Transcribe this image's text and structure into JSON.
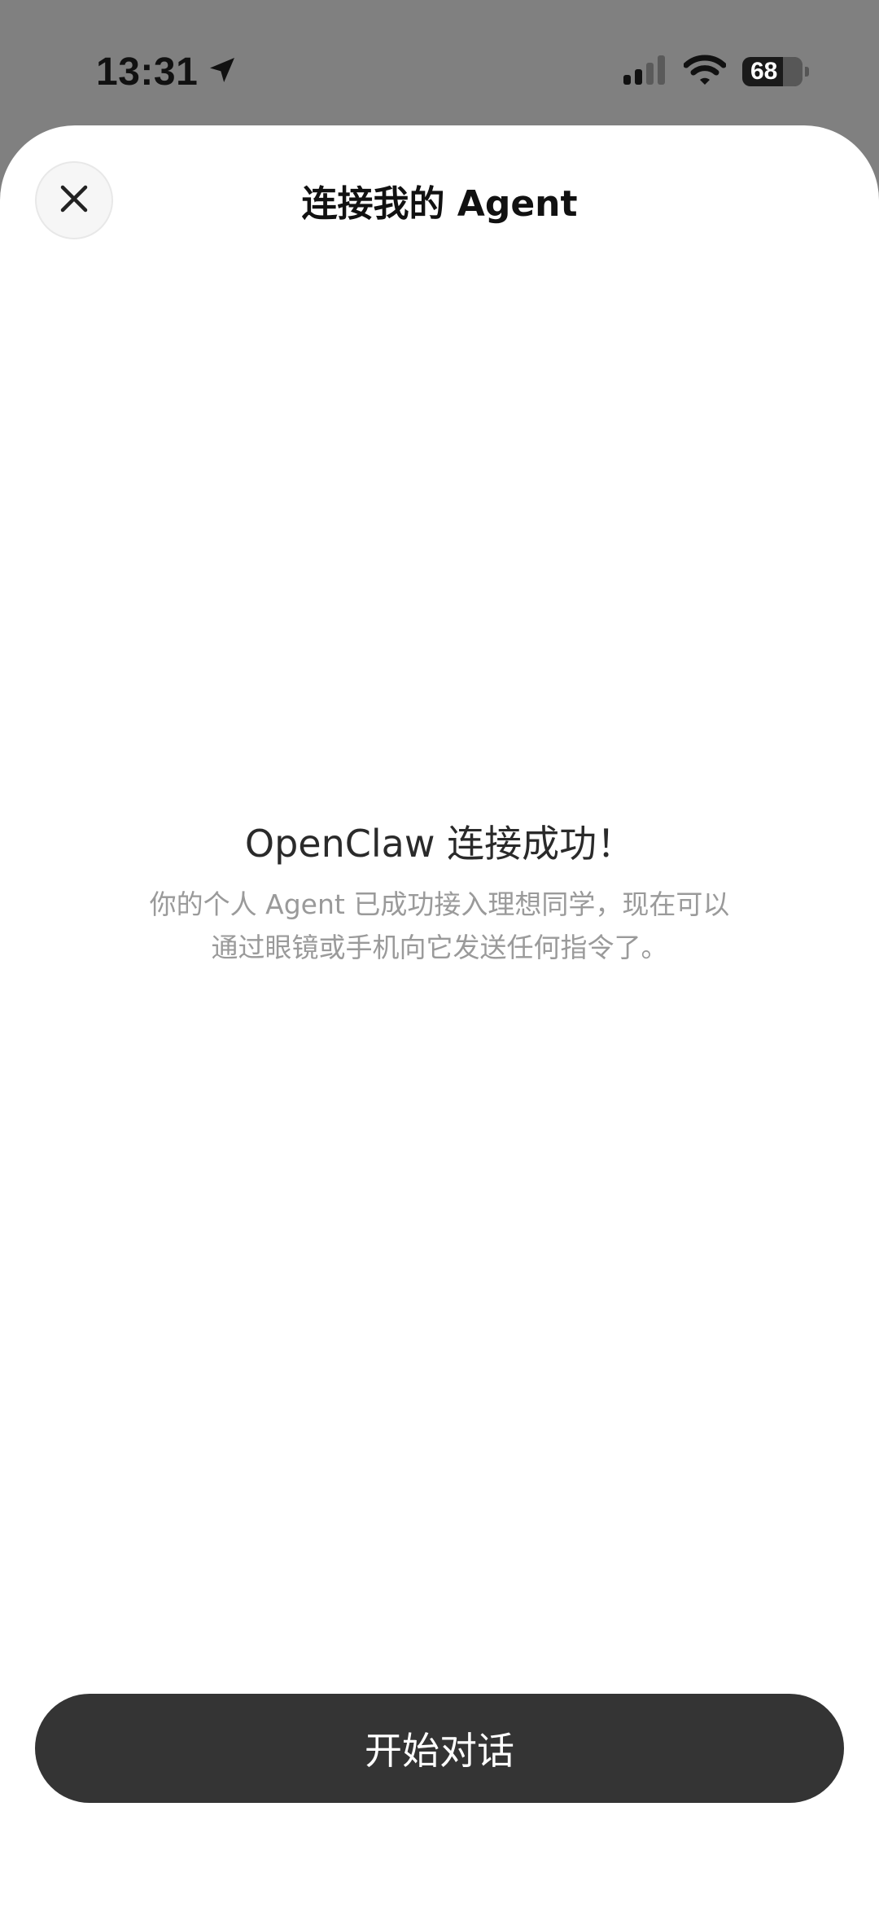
{
  "status_bar": {
    "time": "13:31",
    "location_icon": "location-arrow-icon",
    "signal_icon": "cellular-signal-icon",
    "wifi_icon": "wifi-icon",
    "battery_level": "68",
    "battery_percent": 68
  },
  "sheet": {
    "title": "连接我的 Agent",
    "close_icon": "close-icon"
  },
  "content": {
    "success_title": "OpenClaw 连接成功！",
    "description_line1": "你的个人 Agent 已成功接入理想同学，现在可以",
    "description_line2": "通过眼镜或手机向它发送任何指令了。"
  },
  "footer": {
    "start_button_label": "开始对话"
  },
  "colors": {
    "backdrop": "#808080",
    "sheet_bg": "#ffffff",
    "button_bg": "#343434",
    "muted_text": "#9a9a9a"
  }
}
